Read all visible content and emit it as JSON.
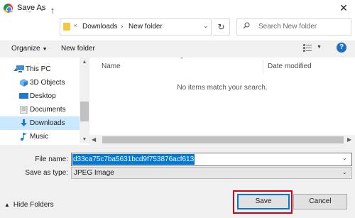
{
  "window": {
    "title": "Save As",
    "close_glyph": "✕"
  },
  "nav": {
    "back_glyph": "←",
    "forward_glyph": "→",
    "dropdown_glyph": "⌄",
    "up_glyph": "↑",
    "breadcrumb": [
      "Downloads",
      "New folder"
    ],
    "breadcrumb_sep": "›",
    "overflow_glyph": "«",
    "refresh_glyph": "↻"
  },
  "search": {
    "placeholder": "Search New folder"
  },
  "toolbar": {
    "organize_label": "Organize",
    "new_folder_label": "New folder",
    "help_glyph": "?"
  },
  "sidebar": {
    "items": [
      {
        "label": "This PC",
        "icon": "pc-icon"
      },
      {
        "label": "3D Objects",
        "icon": "cube-icon"
      },
      {
        "label": "Desktop",
        "icon": "desktop-icon"
      },
      {
        "label": "Documents",
        "icon": "documents-icon"
      },
      {
        "label": "Downloads",
        "icon": "download-icon",
        "selected": true
      },
      {
        "label": "Music",
        "icon": "music-icon"
      }
    ]
  },
  "file_list": {
    "columns": [
      "Name",
      "Date modified"
    ],
    "empty_message": "No items match your search."
  },
  "form": {
    "file_name_label": "File name:",
    "file_name_value": "d33ca75c7ba5631bcd9f753876acf613",
    "save_type_label": "Save as type:",
    "save_type_value": "JPEG Image"
  },
  "footer": {
    "hide_folders_label": "Hide Folders",
    "save_label": "Save",
    "cancel_label": "Cancel"
  },
  "colors": {
    "accent": "#0078d7",
    "highlight_box": "#d0021b",
    "selected_bg": "#cce8ff"
  }
}
